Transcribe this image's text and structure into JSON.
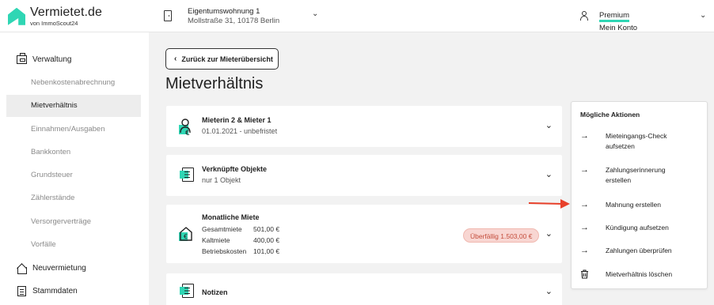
{
  "header": {
    "logo_title": "Vermietet.de",
    "logo_sub": "von ImmoScout24",
    "property_name": "Eigentumswohnung 1",
    "property_address": "Mollstraße 31, 10178 Berlin",
    "account_badge": "Premium",
    "account_label": "Mein Konto"
  },
  "sidebar": {
    "verwaltung": "Verwaltung",
    "items": [
      {
        "label": "Nebenkostenabrechnung",
        "active": false
      },
      {
        "label": "Mietverhältnis",
        "active": true
      },
      {
        "label": "Einnahmen/Ausgaben",
        "active": false
      },
      {
        "label": "Bankkonten",
        "active": false
      },
      {
        "label": "Grundsteuer",
        "active": false
      },
      {
        "label": "Zählerstände",
        "active": false
      },
      {
        "label": "Versorgerverträge",
        "active": false
      },
      {
        "label": "Vorfälle",
        "active": false
      }
    ],
    "neuvermietung": "Neuvermietung",
    "stammdaten": "Stammdaten"
  },
  "main": {
    "back_label": "Zurück zur Mieterübersicht",
    "page_title": "Mietverhältnis",
    "tenants_card": {
      "title": "Mieterin 2 & Mieter 1",
      "sub": "01.01.2021 - unbefristet"
    },
    "objects_card": {
      "title": "Verknüpfte Objekte",
      "sub": "nur 1 Objekt"
    },
    "rent_card": {
      "title": "Monatliche Miete",
      "rows": [
        {
          "label": "Gesamtmiete",
          "value": "501,00 €"
        },
        {
          "label": "Kaltmiete",
          "value": "400,00 €"
        },
        {
          "label": "Betriebskosten",
          "value": "101,00 €"
        }
      ],
      "overdue": "Überfällig 1.503,00 €"
    },
    "notes_card": {
      "title": "Notizen"
    }
  },
  "actions": {
    "title": "Mögliche Aktionen",
    "items": [
      {
        "label": "Mieteingangs-Check aufsetzen",
        "icon": "arrow-right-icon"
      },
      {
        "label": "Zahlungserinnerung erstellen",
        "icon": "arrow-right-icon"
      },
      {
        "label": "Mahnung erstellen",
        "icon": "arrow-right-icon"
      },
      {
        "label": "Kündigung aufsetzen",
        "icon": "arrow-right-icon"
      },
      {
        "label": "Zahlungen überprüfen",
        "icon": "arrow-right-icon"
      },
      {
        "label": "Mietverhältnis löschen",
        "icon": "trash-icon"
      }
    ]
  },
  "colors": {
    "accent": "#2fd6b4",
    "overdue_bg": "#f8d6d2",
    "overdue_text": "#c44d3c",
    "annotation_arrow": "#e8402a"
  }
}
